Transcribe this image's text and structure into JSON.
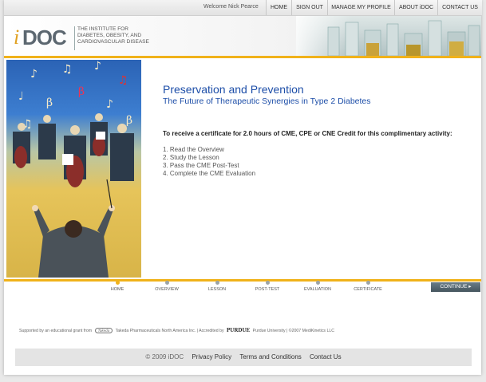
{
  "nav": {
    "welcome": "Welcome Nick Pearce",
    "items": [
      {
        "label": "HOME"
      },
      {
        "label": "SIGN OUT"
      },
      {
        "label": "MANAGE MY PROFILE"
      },
      {
        "label": "ABOUT iDOC"
      },
      {
        "label": "CONTACT US"
      }
    ]
  },
  "logo": {
    "i": "i",
    "doc": "DOC",
    "line1": "THE INSTITUTE FOR",
    "line2": "DIABETES, OBESITY, AND",
    "line3": "CARDIOVASCULAR DISEASE"
  },
  "main": {
    "title": "Preservation and Prevention",
    "subtitle": "The Future of Therapeutic Synergies in Type 2 Diabetes",
    "certificate": "To receive a certificate for 2.0 hours of CME, CPE or CNE Credit for this complimentary activity:",
    "steps": [
      "1. Read the Overview",
      "2. Study the Lesson",
      "3. Pass the CME Post-Test",
      "4. Complete the CME Evaluation"
    ]
  },
  "progress": {
    "steps": [
      {
        "label": "HOME",
        "active": true
      },
      {
        "label": "OVERVIEW",
        "active": false
      },
      {
        "label": "LESSON",
        "active": false
      },
      {
        "label": "POST-TEST",
        "active": false
      },
      {
        "label": "EVALUATION",
        "active": false
      },
      {
        "label": "CERTIFICATE",
        "active": false
      }
    ],
    "continue_label": "CONTINUE ▸"
  },
  "support": {
    "text": "Supported by an educational grant from",
    "takeda_logo": "Takeda",
    "takeda": "Takeda Pharmaceuticals North America Inc. |  Accredited by",
    "purdue_logo": "PURDUE",
    "purdue": "Purdue University | ©2007 MediKinetics LLC"
  },
  "footer": {
    "copyright": "© 2009 iDOC",
    "privacy": "Privacy Policy",
    "terms": "Terms and Conditions",
    "contact": "Contact Us"
  },
  "colors": {
    "accent": "#f0b21a",
    "title_blue": "#1d4ea8",
    "continue_bg": "#45555e"
  }
}
